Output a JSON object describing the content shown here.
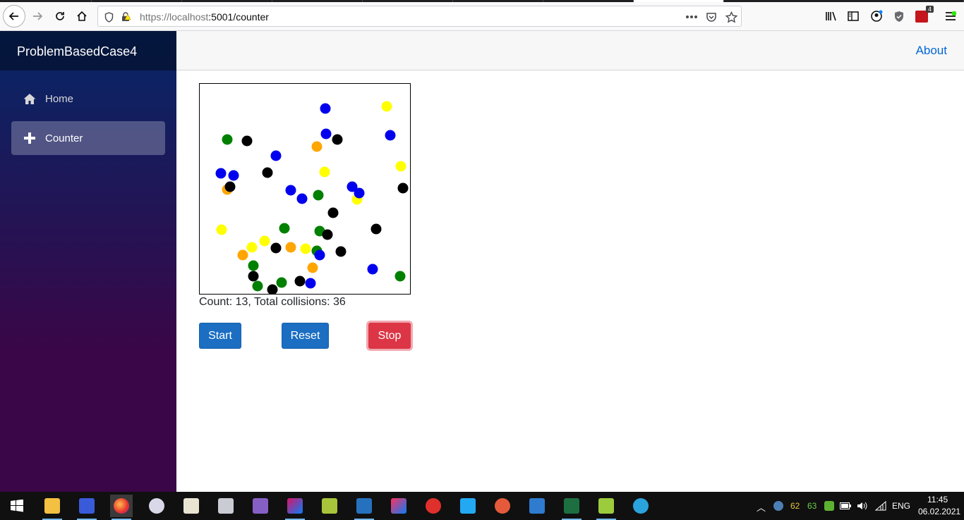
{
  "browser": {
    "url_host": "https://localhost",
    "url_path": ":5001/counter",
    "toolbar_badge": "4"
  },
  "sidebar": {
    "brand": "ProblemBasedCase4",
    "items": [
      {
        "label": "Home",
        "icon": "home-icon"
      },
      {
        "label": "Counter",
        "icon": "plus-icon",
        "active": true
      }
    ]
  },
  "header": {
    "about": "About"
  },
  "simulation": {
    "status": "Count: 13, Total collisions: 36",
    "colors": {
      "blue": "#0000ee",
      "green": "#008000",
      "black": "#000000",
      "yellow": "#ffff00",
      "orange": "#ffa500"
    }
  },
  "buttons": {
    "start": "Start",
    "reset": "Reset",
    "stop": "Stop"
  },
  "taskbar": {
    "apps": [
      "start-menu",
      "file-explorer",
      "save-app",
      "firefox",
      "paint-app",
      "tools-app",
      "image-app",
      "visual-studio",
      "rider",
      "tool-app",
      "powershell",
      "intellij",
      "settings-app",
      "vscode",
      "git-app",
      "virtualbox",
      "excel",
      "notepad-plus",
      "telegram"
    ],
    "tray_num1": "62",
    "tray_num2": "63",
    "language": "ENG",
    "time": "11:45",
    "date": "06.02.2021"
  }
}
